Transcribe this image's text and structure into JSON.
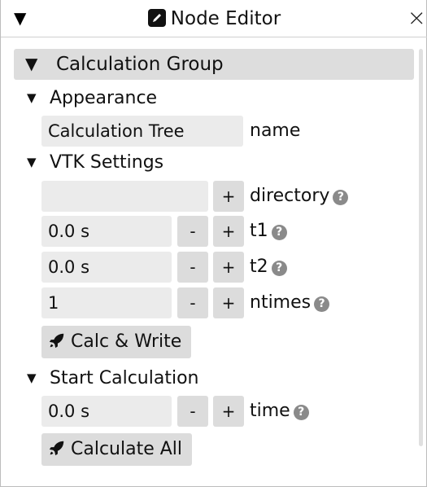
{
  "window": {
    "title": "Node Editor",
    "close_glyph": "×",
    "collapse_glyph": "▼"
  },
  "group": {
    "title": "Calculation Group",
    "expand_glyph": "▼"
  },
  "appearance": {
    "title": "Appearance",
    "name_value": "Calculation Tree",
    "name_label": "name"
  },
  "vtk": {
    "title": "VTK Settings",
    "directory_value": "",
    "directory_label": "directory",
    "t1_value": "0.0 s",
    "t1_label": "t1",
    "t2_value": "0.0 s",
    "t2_label": "t2",
    "ntimes_value": "1",
    "ntimes_label": "ntimes",
    "action_label": "Calc & Write"
  },
  "start": {
    "title": "Start Calculation",
    "time_value": "0.0 s",
    "time_label": "time",
    "action_label": "Calculate All"
  },
  "controls": {
    "minus": "-",
    "plus": "+",
    "help": "?",
    "section_glyph": "▼"
  },
  "icons": {
    "title_icon": "edit-icon",
    "action_icon": "rocket-icon",
    "help_icon": "question-circle-icon"
  }
}
